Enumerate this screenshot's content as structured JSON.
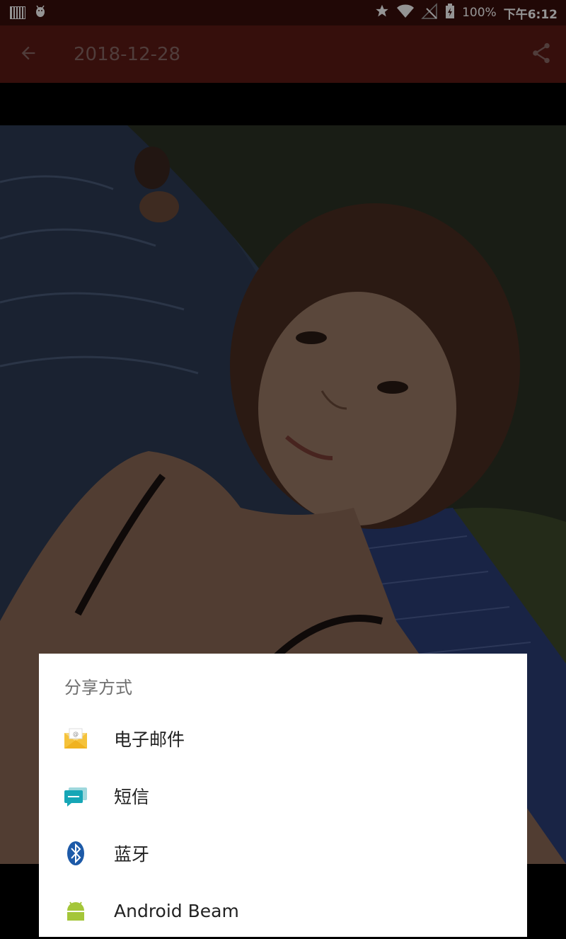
{
  "status_bar": {
    "battery": "100%",
    "time": "下午6:12",
    "icons": [
      "barcode-icon",
      "android-debug-icon",
      "star-icon",
      "wifi-icon",
      "signal-off-icon",
      "battery-charging-icon"
    ]
  },
  "app_bar": {
    "title": "2018-12-28",
    "back_icon": "arrow-back-icon",
    "share_icon": "share-icon"
  },
  "share_sheet": {
    "title": "分享方式",
    "items": [
      {
        "label": "电子邮件",
        "icon": "email-icon"
      },
      {
        "label": "短信",
        "icon": "sms-icon"
      },
      {
        "label": "蓝牙",
        "icon": "bluetooth-icon"
      },
      {
        "label": "Android Beam",
        "icon": "android-icon"
      }
    ]
  },
  "colors": {
    "status_bar": "#3a0e0c",
    "app_bar": "#5e1a16",
    "sheet_bg": "#ffffff"
  }
}
